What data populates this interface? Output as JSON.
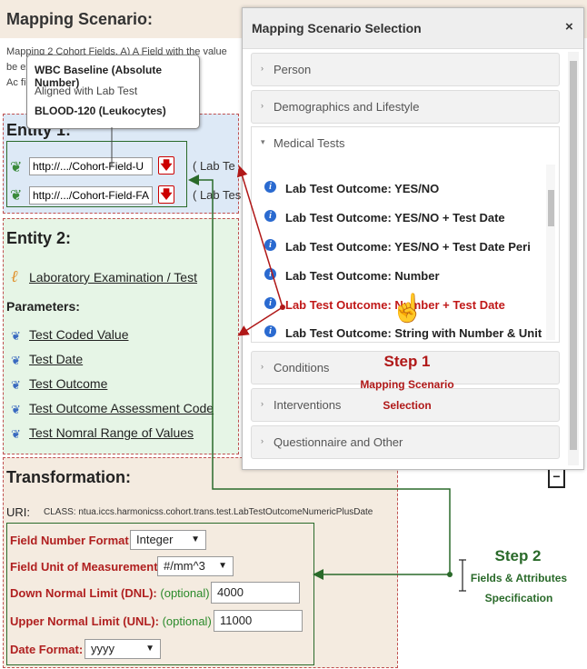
{
  "header": {
    "title": "Mapping Scenario:",
    "description_lines": [
      "Mapping 2 Cohort Fields. A) A Field with the value",
      "be                                       existing in",
      "Ac                                       field) sho"
    ]
  },
  "tooltip": {
    "line1": "WBC Baseline (Absolute Number)",
    "line2": "Aligned with Lab Test",
    "line3": "BLOOD-120 (Leukocytes)"
  },
  "entity1": {
    "title": "Entity 1:",
    "fields": [
      {
        "url": "http://.../Cohort-Field-U",
        "label": "( Lab Te"
      },
      {
        "url": "http://.../Cohort-Field-FA",
        "label": "( Lab Tes"
      }
    ]
  },
  "entity2": {
    "title": "Entity 2:",
    "link": "Laboratory Examination / Test",
    "params_label": "Parameters:",
    "params": [
      "Test Coded Value",
      "Test Date",
      "Test Outcome",
      "Test Outcome Assessment Code",
      "Test Nomral Range of Values"
    ]
  },
  "transformation": {
    "title": "Transformation:",
    "collapse_symbol": "−",
    "uri_label": "URI:",
    "uri_class": "CLASS: ntua.iccs.harmonicss.cohort.trans.test.LabTestOutcomeNumericPlusDate",
    "number_format_label": "Field Number Format:",
    "number_format_value": "Integer",
    "unit_label": "Field Unit of Measurement:",
    "unit_value": "#/mm^3",
    "dnl_label": "Down Normal Limit (DNL):",
    "dnl_optional": "(optional)",
    "dnl_value": "4000",
    "unl_label": "Upper Normal Limit (UNL):",
    "unl_optional": "(optional)",
    "unl_value": "11000",
    "date_format_label": "Date Format:",
    "date_format_value": "yyyy"
  },
  "modal": {
    "title": "Mapping Scenario Selection",
    "close": "×",
    "sections_top": [
      "Person",
      "Demographics and Lifestyle"
    ],
    "open_section": "Medical Tests",
    "items": [
      {
        "label": "Lab Test Outcome: YES/NO",
        "highlight": false
      },
      {
        "label": "Lab Test Outcome: YES/NO + Test Date",
        "highlight": false
      },
      {
        "label": "Lab Test Outcome: YES/NO + Test Date Peri",
        "highlight": false
      },
      {
        "label": "Lab Test Outcome: Number",
        "highlight": false
      },
      {
        "label": "Lab Test Outcome: Number + Test Date",
        "highlight": true
      },
      {
        "label": "Lab Test Outcome: String with Number & Unit",
        "highlight": false
      }
    ],
    "sections_bottom": [
      "Conditions",
      "Interventions",
      "Questionnaire and Other"
    ]
  },
  "annotations": {
    "step1_title": "Step 1",
    "step1_line1": "Mapping Scenario",
    "step1_line2": "Selection",
    "step2_title": "Step 2",
    "step2_line1": "Fields & Attributes",
    "step2_line2": "Specification"
  },
  "colors": {
    "accent_red": "#b01818",
    "accent_green": "#2a6a2a",
    "info_blue": "#2a6ad0"
  }
}
